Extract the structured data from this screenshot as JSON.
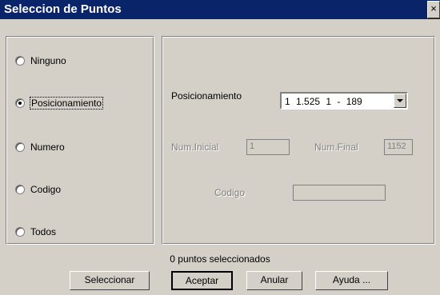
{
  "window": {
    "title": "Seleccion de Puntos",
    "close_glyph": "×"
  },
  "options": [
    {
      "label": "Ninguno",
      "selected": false
    },
    {
      "label": "Posicionamiento",
      "selected": true
    },
    {
      "label": "Numero",
      "selected": false
    },
    {
      "label": "Codigo",
      "selected": false
    },
    {
      "label": "Todos",
      "selected": false
    }
  ],
  "panel": {
    "posicionamiento_label": "Posicionamiento",
    "posicionamiento_value": "1 1.525  1 -  189",
    "num_inicial_label": "Num.Inicial",
    "num_inicial_value": "1",
    "num_final_label": "Num.Final",
    "num_final_value": "1152",
    "codigo_label": "Codigo",
    "codigo_value": ""
  },
  "status": {
    "text": "0 puntos seleccionados"
  },
  "buttons": {
    "seleccionar": "Seleccionar",
    "aceptar": "Aceptar",
    "anular": "Anular",
    "ayuda": "Ayuda ..."
  }
}
